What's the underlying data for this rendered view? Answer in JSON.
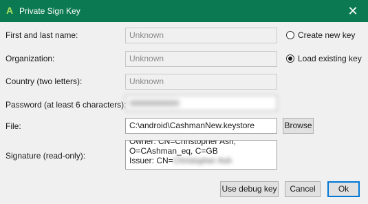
{
  "window": {
    "title": "Private Sign Key",
    "close_glyph": "✕"
  },
  "form": {
    "name_label": "First and last name:",
    "name_value": "Unknown",
    "org_label": "Organization:",
    "org_value": "Unknown",
    "country_label": "Country (two letters):",
    "country_value": "Unknown",
    "password_label": "Password (at least 6 characters):",
    "password_value": "●●●●●●●●●●",
    "file_label": "File:",
    "file_value": "C:\\android\\CashmanNew.keystore",
    "signature_label": "Signature (read-only):",
    "signature_line1": "Owner: CN=Christopher Ash,",
    "signature_line2": "O=CAshman_eq, C=GB",
    "signature_line3_prefix": "Issuer: CN=",
    "signature_line3_blurred": "Christopher Ash"
  },
  "options": {
    "create_new_label": "Create new key",
    "load_existing_label": "Load existing key",
    "selected": "load_existing"
  },
  "buttons": {
    "browse": "Browse",
    "use_debug_key": "Use debug key",
    "cancel": "Cancel",
    "ok": "Ok"
  },
  "colors": {
    "titlebar": "#0b7a52",
    "accent": "#0078d7"
  }
}
